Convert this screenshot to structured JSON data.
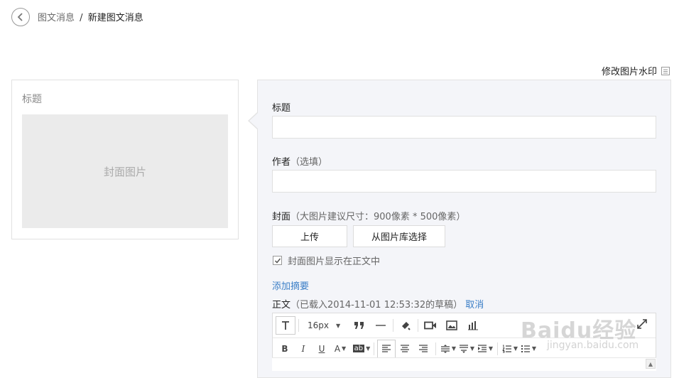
{
  "breadcrumb": {
    "parent": "图文消息",
    "separator": "/",
    "current": "新建图文消息"
  },
  "watermark_link": {
    "label": "修改图片水印"
  },
  "preview": {
    "title": "标题",
    "cover_placeholder": "封面图片"
  },
  "form": {
    "title_label": "标题",
    "title_value": "",
    "author_label": "作者",
    "author_hint": "（选填）",
    "author_value": "",
    "cover_label": "封面",
    "cover_hint": "（大图片建议尺寸：900像素 * 500像素）",
    "upload_button": "上传",
    "library_button": "从图片库选择",
    "show_cover_checked": true,
    "show_cover_label": "封面图片显示在正文中",
    "add_summary": "添加摘要",
    "body_label": "正文",
    "body_hint": "（已载入2014-11-01 12:53:32的草稿）",
    "cancel_link": "取消"
  },
  "toolbar": {
    "font_size": "16px",
    "row1_icons": [
      "text-format-icon",
      "blockquote-icon",
      "horizontal-rule-icon",
      "format-brush-icon",
      "video-icon",
      "image-icon",
      "chart-icon"
    ],
    "row2_icons": [
      "bold-icon",
      "italic-icon",
      "underline-icon",
      "font-color-icon",
      "background-color-icon",
      "align-left-icon",
      "align-center-icon",
      "align-right-icon",
      "line-spacing-icon",
      "paragraph-spacing-icon",
      "indent-icon",
      "ordered-list-icon",
      "unordered-list-icon"
    ],
    "bold": "B",
    "italic": "I",
    "underline": "U",
    "font_color": "A",
    "bg_color": "ab"
  },
  "site_watermark": {
    "brand": "Baidu经验",
    "url": "jingyan.baidu.com"
  }
}
